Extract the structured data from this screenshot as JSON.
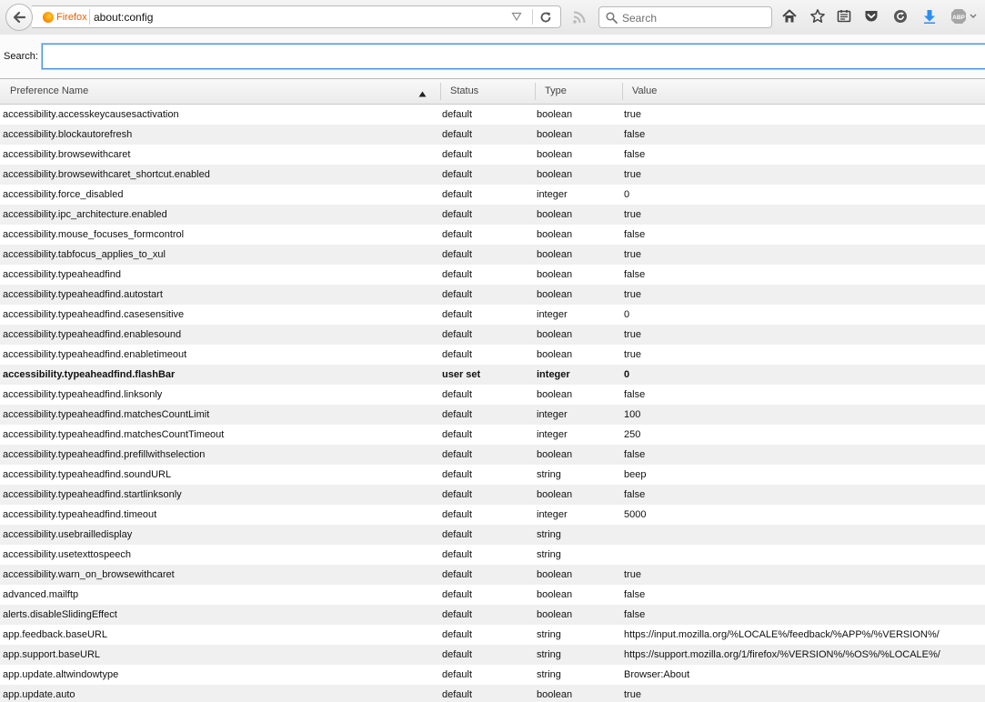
{
  "browser": {
    "identity_label": "Firefox",
    "url": "about:config",
    "search_placeholder": "Search",
    "colors": {
      "identity": "#e66000",
      "download": "#2b8ef3"
    }
  },
  "config": {
    "search_label": "Search:",
    "search_value": "",
    "columns": {
      "name": "Preference Name",
      "status": "Status",
      "type": "Type",
      "value": "Value"
    },
    "rows": [
      {
        "name": "accessibility.accesskeycausesactivation",
        "status": "default",
        "type": "boolean",
        "value": "true"
      },
      {
        "name": "accessibility.blockautorefresh",
        "status": "default",
        "type": "boolean",
        "value": "false"
      },
      {
        "name": "accessibility.browsewithcaret",
        "status": "default",
        "type": "boolean",
        "value": "false"
      },
      {
        "name": "accessibility.browsewithcaret_shortcut.enabled",
        "status": "default",
        "type": "boolean",
        "value": "true"
      },
      {
        "name": "accessibility.force_disabled",
        "status": "default",
        "type": "integer",
        "value": "0"
      },
      {
        "name": "accessibility.ipc_architecture.enabled",
        "status": "default",
        "type": "boolean",
        "value": "true"
      },
      {
        "name": "accessibility.mouse_focuses_formcontrol",
        "status": "default",
        "type": "boolean",
        "value": "false"
      },
      {
        "name": "accessibility.tabfocus_applies_to_xul",
        "status": "default",
        "type": "boolean",
        "value": "true"
      },
      {
        "name": "accessibility.typeaheadfind",
        "status": "default",
        "type": "boolean",
        "value": "false"
      },
      {
        "name": "accessibility.typeaheadfind.autostart",
        "status": "default",
        "type": "boolean",
        "value": "true"
      },
      {
        "name": "accessibility.typeaheadfind.casesensitive",
        "status": "default",
        "type": "integer",
        "value": "0"
      },
      {
        "name": "accessibility.typeaheadfind.enablesound",
        "status": "default",
        "type": "boolean",
        "value": "true"
      },
      {
        "name": "accessibility.typeaheadfind.enabletimeout",
        "status": "default",
        "type": "boolean",
        "value": "true"
      },
      {
        "name": "accessibility.typeaheadfind.flashBar",
        "status": "user set",
        "type": "integer",
        "value": "0"
      },
      {
        "name": "accessibility.typeaheadfind.linksonly",
        "status": "default",
        "type": "boolean",
        "value": "false"
      },
      {
        "name": "accessibility.typeaheadfind.matchesCountLimit",
        "status": "default",
        "type": "integer",
        "value": "100"
      },
      {
        "name": "accessibility.typeaheadfind.matchesCountTimeout",
        "status": "default",
        "type": "integer",
        "value": "250"
      },
      {
        "name": "accessibility.typeaheadfind.prefillwithselection",
        "status": "default",
        "type": "boolean",
        "value": "false"
      },
      {
        "name": "accessibility.typeaheadfind.soundURL",
        "status": "default",
        "type": "string",
        "value": "beep"
      },
      {
        "name": "accessibility.typeaheadfind.startlinksonly",
        "status": "default",
        "type": "boolean",
        "value": "false"
      },
      {
        "name": "accessibility.typeaheadfind.timeout",
        "status": "default",
        "type": "integer",
        "value": "5000"
      },
      {
        "name": "accessibility.usebrailledisplay",
        "status": "default",
        "type": "string",
        "value": ""
      },
      {
        "name": "accessibility.usetexttospeech",
        "status": "default",
        "type": "string",
        "value": ""
      },
      {
        "name": "accessibility.warn_on_browsewithcaret",
        "status": "default",
        "type": "boolean",
        "value": "true"
      },
      {
        "name": "advanced.mailftp",
        "status": "default",
        "type": "boolean",
        "value": "false"
      },
      {
        "name": "alerts.disableSlidingEffect",
        "status": "default",
        "type": "boolean",
        "value": "false"
      },
      {
        "name": "app.feedback.baseURL",
        "status": "default",
        "type": "string",
        "value": "https://input.mozilla.org/%LOCALE%/feedback/%APP%/%VERSION%/"
      },
      {
        "name": "app.support.baseURL",
        "status": "default",
        "type": "string",
        "value": "https://support.mozilla.org/1/firefox/%VERSION%/%OS%/%LOCALE%/"
      },
      {
        "name": "app.update.altwindowtype",
        "status": "default",
        "type": "string",
        "value": "Browser:About"
      },
      {
        "name": "app.update.auto",
        "status": "default",
        "type": "boolean",
        "value": "true"
      }
    ]
  }
}
